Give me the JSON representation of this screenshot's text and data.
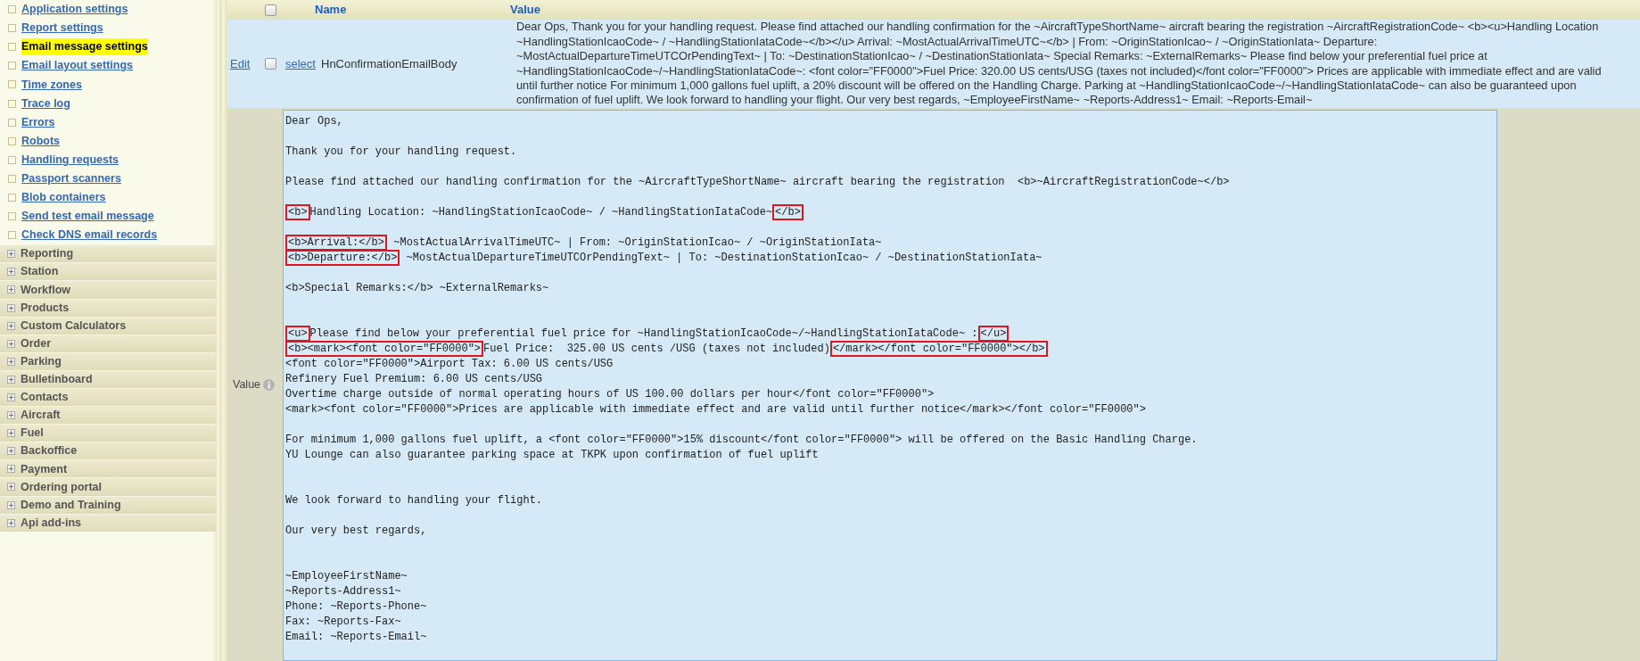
{
  "sidebar": {
    "links": [
      {
        "label": "Application settings",
        "selected": false
      },
      {
        "label": "Report settings",
        "selected": false
      },
      {
        "label": "Email message settings",
        "selected": true
      },
      {
        "label": "Email layout settings",
        "selected": false
      },
      {
        "label": "Time zones",
        "selected": false
      },
      {
        "label": "Trace log",
        "selected": false
      },
      {
        "label": "Errors",
        "selected": false
      },
      {
        "label": "Robots",
        "selected": false
      },
      {
        "label": "Handling requests",
        "selected": false
      },
      {
        "label": "Passport scanners",
        "selected": false
      },
      {
        "label": "Blob containers",
        "selected": false
      },
      {
        "label": "Send test email message",
        "selected": false
      },
      {
        "label": "Check DNS email records",
        "selected": false
      }
    ],
    "groups": [
      "Reporting",
      "Station",
      "Workflow",
      "Products",
      "Custom Calculators",
      "Order",
      "Parking",
      "Bulletinboard",
      "Contacts",
      "Aircraft",
      "Fuel",
      "Backoffice",
      "Payment",
      "Ordering portal",
      "Demo and Training",
      "Api add-ins"
    ]
  },
  "table": {
    "header_checkbox": {
      "checked": false
    },
    "columns": [
      "Name",
      "Value"
    ],
    "row": {
      "edit_link": "Edit",
      "checked": false,
      "select_link": "select",
      "name": "HnConfirmationEmailBody",
      "value_lines": [
        "Dear Ops, Thank you for your handling request. Please find attached our handling confirmation for the ~AircraftTypeShortName~ aircraft bearing the registration ~AircraftRegistrationCode~ <b><u>Handling Location",
        "~HandlingStationIcaoCode~ / ~HandlingStationIataCode~</b></u> Arrival: ~MostActualArrivalTimeUTC~</b> | From: ~OriginStationIcao~ / ~OriginStationIata~ Departure:",
        "~MostActualDepartureTimeUTCOrPendingText~ | To: ~DestinationStationIcao~ / ~DestinationStationIata~ Special Remarks: ~ExternalRemarks~ Please find below your preferential fuel price at",
        "~HandlingStationIcaoCode~/~HandlingStationIataCode~: <font color=\"FF0000\">Fuel Price: 320.00 US cents/USG (taxes not included)</font color=\"FF0000\"> Prices are applicable with immediate effect and are valid",
        "until further notice For minimum 1,000 gallons fuel uplift, a 20% discount will be offered on the Handling Charge. Parking at ~HandlingStationIcaoCode~/~HandlingStationIataCode~ can also be guaranteed upon",
        "confirmation of fuel uplift. We look forward to handling your flight. Our very best regards, ~EmployeeFirstName~ ~Reports-Address1~ Email: ~Reports-Email~"
      ]
    }
  },
  "editor": {
    "label": "Value",
    "lines": [
      {
        "kind": "text",
        "text": "Dear Ops,"
      },
      {
        "kind": "blank"
      },
      {
        "kind": "text",
        "text": "Thank you for your handling request."
      },
      {
        "kind": "blank"
      },
      {
        "kind": "text",
        "text": "Please find attached our handling confirmation for the ~AircraftTypeShortName~ aircraft bearing the registration  <b>~AircraftRegistrationCode~</b>"
      },
      {
        "kind": "blank"
      },
      {
        "kind": "tagged",
        "segments": [
          {
            "text": "<b>",
            "boxed": true
          },
          {
            "text": "Handling Location: ~HandlingStationIcaoCode~ / ~HandlingStationIataCode~",
            "boxed": false
          },
          {
            "text": "</b>",
            "boxed": true
          }
        ]
      },
      {
        "kind": "blank"
      },
      {
        "kind": "tagged",
        "segments": [
          {
            "text": "<b>Arrival:</b>",
            "boxed": true
          },
          {
            "text": " ~MostActualArrivalTimeUTC~ | From: ~OriginStationIcao~ / ~OriginStationIata~",
            "boxed": false
          }
        ]
      },
      {
        "kind": "tagged",
        "segments": [
          {
            "text": "<b>Departure:</b>",
            "boxed": true
          },
          {
            "text": " ~MostActualDepartureTimeUTCOrPendingText~ | To: ~DestinationStationIcao~ / ~DestinationStationIata~",
            "boxed": false
          }
        ]
      },
      {
        "kind": "blank"
      },
      {
        "kind": "text",
        "text": "<b>Special Remarks:</b> ~ExternalRemarks~"
      },
      {
        "kind": "blank"
      },
      {
        "kind": "blank"
      },
      {
        "kind": "tagged",
        "segments": [
          {
            "text": "<u>",
            "boxed": true
          },
          {
            "text": "Please find below your preferential fuel price for ~HandlingStationIcaoCode~/~HandlingStationIataCode~ :",
            "boxed": false
          },
          {
            "text": "</u>",
            "boxed": true
          }
        ]
      },
      {
        "kind": "tagged",
        "segments": [
          {
            "text": "<b><mark><font color=\"FF0000\">",
            "boxed": true
          },
          {
            "text": "Fuel Price:  325.00 US cents /USG (taxes not included)",
            "boxed": false
          },
          {
            "text": "</mark></font color=\"FF0000\"></b>",
            "boxed": true
          }
        ]
      },
      {
        "kind": "text",
        "text": "<font color=\"FF0000\">Airport Tax: 6.00 US cents/USG"
      },
      {
        "kind": "text",
        "text": "Refinery Fuel Premium: 6.00 US cents/USG"
      },
      {
        "kind": "text",
        "text": "Overtime charge outside of normal operating hours of US 100.00 dollars per hour</font color=\"FF0000\">"
      },
      {
        "kind": "text",
        "text": "<mark><font color=\"FF0000\">Prices are applicable with immediate effect and are valid until further notice</mark></font color=\"FF0000\">"
      },
      {
        "kind": "blank"
      },
      {
        "kind": "text",
        "text": "For minimum 1,000 gallons fuel uplift, a <font color=\"FF0000\">15% discount</font color=\"FF0000\"> will be offered on the Basic Handling Charge."
      },
      {
        "kind": "text",
        "text": "YU Lounge can also guarantee parking space at TKPK upon confirmation of fuel uplift"
      },
      {
        "kind": "blank"
      },
      {
        "kind": "blank"
      },
      {
        "kind": "text",
        "text": "We look forward to handling your flight."
      },
      {
        "kind": "blank"
      },
      {
        "kind": "text",
        "text": "Our very best regards,"
      },
      {
        "kind": "blank"
      },
      {
        "kind": "blank"
      },
      {
        "kind": "text",
        "text": "~EmployeeFirstName~"
      },
      {
        "kind": "text",
        "text": "~Reports-Address1~"
      },
      {
        "kind": "text",
        "text": "Phone: ~Reports-Phone~"
      },
      {
        "kind": "text",
        "text": "Fax: ~Reports-Fax~"
      },
      {
        "kind": "text",
        "text": "Email: ~Reports-Email~"
      }
    ]
  }
}
